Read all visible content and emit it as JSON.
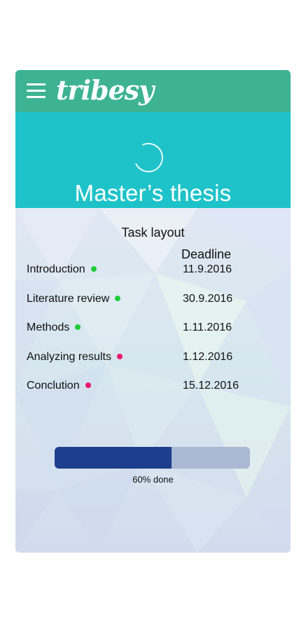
{
  "app": {
    "brand": "tribesy",
    "menu_icon": "hamburger-menu-icon"
  },
  "header": {
    "title": "Master’s thesis",
    "loading_icon": "loading-spinner-icon"
  },
  "tasks": {
    "heading": "Task layout",
    "deadline_heading": "Deadline",
    "items": [
      {
        "label": "Introduction",
        "deadline": "11.9.2016",
        "status": "done",
        "status_color": "#1fcc3a"
      },
      {
        "label": "Literature review",
        "deadline": "30.9.2016",
        "status": "done",
        "status_color": "#1fcc3a"
      },
      {
        "label": "Methods",
        "deadline": "1.11.2016",
        "status": "done",
        "status_color": "#1fcc3a"
      },
      {
        "label": "Analyzing results",
        "deadline": "1.12.2016",
        "status": "pending",
        "status_color": "#e8196a"
      },
      {
        "label": "Conclution",
        "deadline": "15.12.2016",
        "status": "pending",
        "status_color": "#e8196a"
      }
    ]
  },
  "progress": {
    "value": 0.6,
    "label": "60% done",
    "fill_color": "#1d3e8c",
    "track_color": "#aab8d4"
  },
  "colors": {
    "topbar": "#3db394",
    "header": "#1ec3c9"
  }
}
